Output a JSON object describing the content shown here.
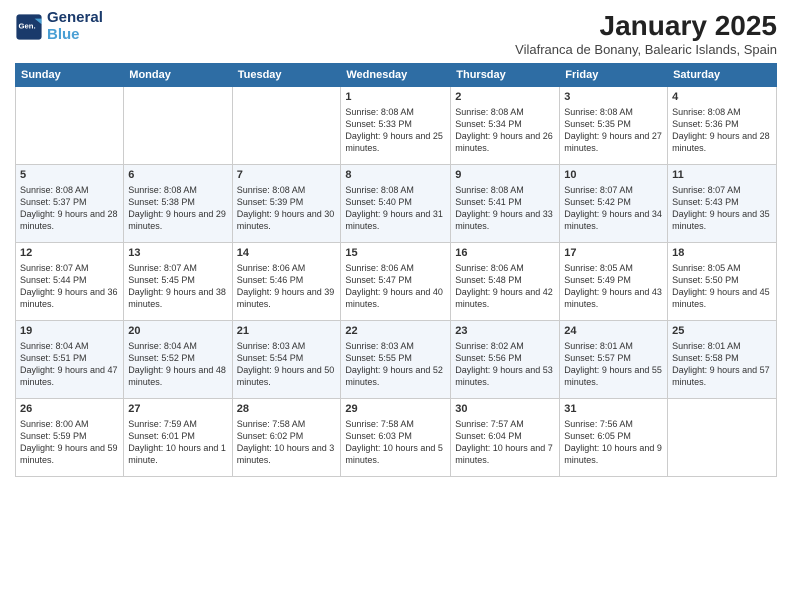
{
  "header": {
    "logo_line1": "General",
    "logo_line2": "Blue",
    "month": "January 2025",
    "location": "Vilafranca de Bonany, Balearic Islands, Spain"
  },
  "weekdays": [
    "Sunday",
    "Monday",
    "Tuesday",
    "Wednesday",
    "Thursday",
    "Friday",
    "Saturday"
  ],
  "weeks": [
    [
      {
        "day": "",
        "empty": true
      },
      {
        "day": "",
        "empty": true
      },
      {
        "day": "",
        "empty": true
      },
      {
        "day": "1",
        "sunrise": "8:08 AM",
        "sunset": "5:33 PM",
        "daylight": "9 hours and 25 minutes."
      },
      {
        "day": "2",
        "sunrise": "8:08 AM",
        "sunset": "5:34 PM",
        "daylight": "9 hours and 26 minutes."
      },
      {
        "day": "3",
        "sunrise": "8:08 AM",
        "sunset": "5:35 PM",
        "daylight": "9 hours and 27 minutes."
      },
      {
        "day": "4",
        "sunrise": "8:08 AM",
        "sunset": "5:36 PM",
        "daylight": "9 hours and 28 minutes."
      }
    ],
    [
      {
        "day": "5",
        "sunrise": "8:08 AM",
        "sunset": "5:37 PM",
        "daylight": "9 hours and 28 minutes."
      },
      {
        "day": "6",
        "sunrise": "8:08 AM",
        "sunset": "5:38 PM",
        "daylight": "9 hours and 29 minutes."
      },
      {
        "day": "7",
        "sunrise": "8:08 AM",
        "sunset": "5:39 PM",
        "daylight": "9 hours and 30 minutes."
      },
      {
        "day": "8",
        "sunrise": "8:08 AM",
        "sunset": "5:40 PM",
        "daylight": "9 hours and 31 minutes."
      },
      {
        "day": "9",
        "sunrise": "8:08 AM",
        "sunset": "5:41 PM",
        "daylight": "9 hours and 33 minutes."
      },
      {
        "day": "10",
        "sunrise": "8:07 AM",
        "sunset": "5:42 PM",
        "daylight": "9 hours and 34 minutes."
      },
      {
        "day": "11",
        "sunrise": "8:07 AM",
        "sunset": "5:43 PM",
        "daylight": "9 hours and 35 minutes."
      }
    ],
    [
      {
        "day": "12",
        "sunrise": "8:07 AM",
        "sunset": "5:44 PM",
        "daylight": "9 hours and 36 minutes."
      },
      {
        "day": "13",
        "sunrise": "8:07 AM",
        "sunset": "5:45 PM",
        "daylight": "9 hours and 38 minutes."
      },
      {
        "day": "14",
        "sunrise": "8:06 AM",
        "sunset": "5:46 PM",
        "daylight": "9 hours and 39 minutes."
      },
      {
        "day": "15",
        "sunrise": "8:06 AM",
        "sunset": "5:47 PM",
        "daylight": "9 hours and 40 minutes."
      },
      {
        "day": "16",
        "sunrise": "8:06 AM",
        "sunset": "5:48 PM",
        "daylight": "9 hours and 42 minutes."
      },
      {
        "day": "17",
        "sunrise": "8:05 AM",
        "sunset": "5:49 PM",
        "daylight": "9 hours and 43 minutes."
      },
      {
        "day": "18",
        "sunrise": "8:05 AM",
        "sunset": "5:50 PM",
        "daylight": "9 hours and 45 minutes."
      }
    ],
    [
      {
        "day": "19",
        "sunrise": "8:04 AM",
        "sunset": "5:51 PM",
        "daylight": "9 hours and 47 minutes."
      },
      {
        "day": "20",
        "sunrise": "8:04 AM",
        "sunset": "5:52 PM",
        "daylight": "9 hours and 48 minutes."
      },
      {
        "day": "21",
        "sunrise": "8:03 AM",
        "sunset": "5:54 PM",
        "daylight": "9 hours and 50 minutes."
      },
      {
        "day": "22",
        "sunrise": "8:03 AM",
        "sunset": "5:55 PM",
        "daylight": "9 hours and 52 minutes."
      },
      {
        "day": "23",
        "sunrise": "8:02 AM",
        "sunset": "5:56 PM",
        "daylight": "9 hours and 53 minutes."
      },
      {
        "day": "24",
        "sunrise": "8:01 AM",
        "sunset": "5:57 PM",
        "daylight": "9 hours and 55 minutes."
      },
      {
        "day": "25",
        "sunrise": "8:01 AM",
        "sunset": "5:58 PM",
        "daylight": "9 hours and 57 minutes."
      }
    ],
    [
      {
        "day": "26",
        "sunrise": "8:00 AM",
        "sunset": "5:59 PM",
        "daylight": "9 hours and 59 minutes."
      },
      {
        "day": "27",
        "sunrise": "7:59 AM",
        "sunset": "6:01 PM",
        "daylight": "10 hours and 1 minute."
      },
      {
        "day": "28",
        "sunrise": "7:58 AM",
        "sunset": "6:02 PM",
        "daylight": "10 hours and 3 minutes."
      },
      {
        "day": "29",
        "sunrise": "7:58 AM",
        "sunset": "6:03 PM",
        "daylight": "10 hours and 5 minutes."
      },
      {
        "day": "30",
        "sunrise": "7:57 AM",
        "sunset": "6:04 PM",
        "daylight": "10 hours and 7 minutes."
      },
      {
        "day": "31",
        "sunrise": "7:56 AM",
        "sunset": "6:05 PM",
        "daylight": "10 hours and 9 minutes."
      },
      {
        "day": "",
        "empty": true
      }
    ]
  ]
}
